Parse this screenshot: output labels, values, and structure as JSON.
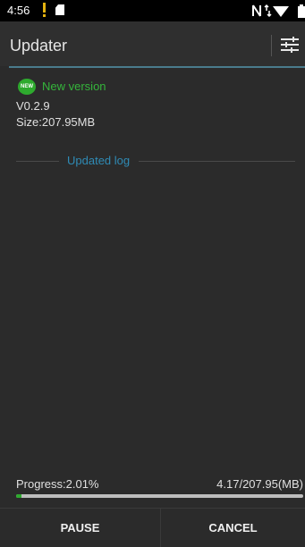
{
  "status_bar": {
    "time": "4:56",
    "icons": [
      "alert-icon",
      "sd-card-icon",
      "nfc-icon",
      "data-arrows-icon",
      "wifi-icon",
      "battery-icon"
    ]
  },
  "toolbar": {
    "title": "Updater",
    "settings_icon": "tune-sliders-icon"
  },
  "update": {
    "badge": "NEW",
    "badge_color": "#2eaa2e",
    "label": "New version",
    "label_color": "#35b53b",
    "version": "V0.2.9",
    "size": "Size:207.95MB"
  },
  "log": {
    "title": "Updated log",
    "title_color": "#2f8bb5"
  },
  "progress": {
    "label": "Progress:2.01%",
    "size": "4.17/207.95(MB)",
    "fraction": 0.0201,
    "fill_color": "#2eaa2e"
  },
  "buttons": {
    "pause": "PAUSE",
    "cancel": "CANCEL"
  }
}
